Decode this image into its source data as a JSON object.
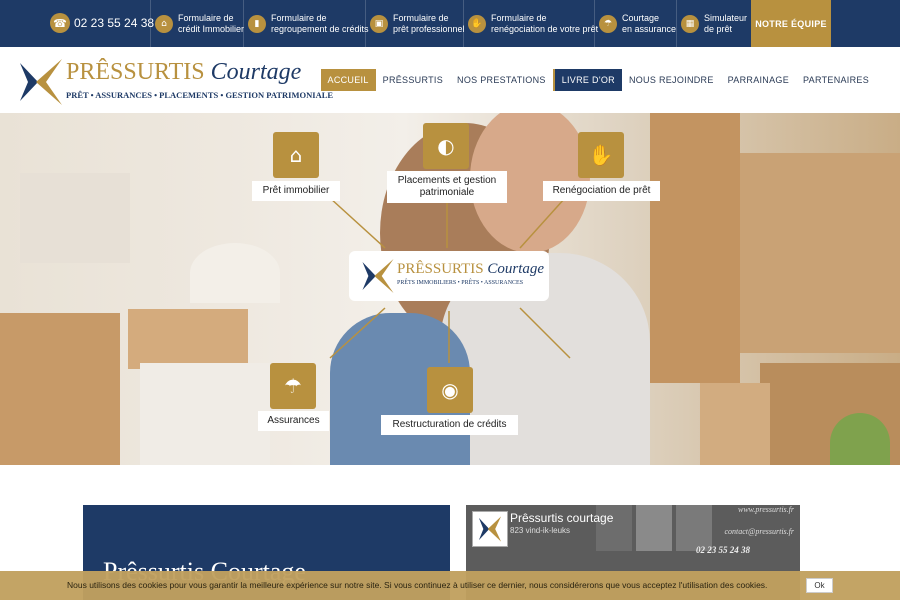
{
  "topbar": {
    "phone": "02 23 55 24 38",
    "items": [
      {
        "line1": "Formulaire de",
        "line2": "crédit Immobilier",
        "icon": "house-icon"
      },
      {
        "line1": "Formulaire de",
        "line2": "regroupement de crédits",
        "icon": "chart-icon"
      },
      {
        "line1": "Formulaire de",
        "line2": "prêt professionnel",
        "icon": "briefcase-icon"
      },
      {
        "line1": "Formulaire de",
        "line2": "renégociation de votre prêt",
        "icon": "handshake-icon"
      },
      {
        "line1": "Courtage",
        "line2": "en assurance",
        "icon": "umbrella-icon"
      },
      {
        "line1": "Simulateur",
        "line2": "de prêt",
        "icon": "calculator-icon"
      }
    ],
    "team_button": "NOTRE ÉQUIPE"
  },
  "header": {
    "logo": {
      "brand_main": "PRÊSSURTIS",
      "brand_secondary": "Courtage",
      "tagline": "PRÊT • ASSURANCES • PLACEMENTS • GESTION PATRIMONIALE"
    },
    "nav": [
      "ACCUEIL",
      "PRÊSSURTIS",
      "NOS PRESTATIONS",
      "LIVRE D'OR",
      "NOUS REJOINDRE",
      "PARRAINAGE",
      "PARTENAIRES"
    ]
  },
  "hero": {
    "services": [
      {
        "label": "Prêt immobilier",
        "icon": "house-euro-icon"
      },
      {
        "label": "Placements et gestion\npatrimoniale",
        "icon": "piggy-bank-icon"
      },
      {
        "label": "Renégociation de prêt",
        "icon": "handshake-icon"
      },
      {
        "label": "Assurances",
        "icon": "umbrella-icon"
      },
      {
        "label": "Restructuration de crédits",
        "icon": "coins-icon"
      }
    ],
    "center_logo": {
      "brand_main": "PRÊSSURTIS",
      "brand_secondary": "Courtage",
      "tagline": "PRÊTS IMMOBILIERS • PRÊTS • ASSURANCES"
    }
  },
  "main": {
    "left_title": "Prêssurtis Courtage",
    "facebook": {
      "name": "Prêssurtis courtage",
      "likes": "823 vind-ik-leuks",
      "site": "www.pressurtis.fr",
      "contact": "contact@pressurtis.fr",
      "phone": "02 23 55 24 38"
    }
  },
  "cookie": {
    "text": "Nous utilisons des cookies pour vous garantir la meilleure expérience sur notre site. Si vous continuez à utiliser ce dernier, nous considérerons que vous acceptez l'utilisation des cookies.",
    "ok": "Ok"
  },
  "colors": {
    "navy": "#1e3a66",
    "gold": "#b8913f",
    "cookie_bg": "#c1a05f"
  }
}
